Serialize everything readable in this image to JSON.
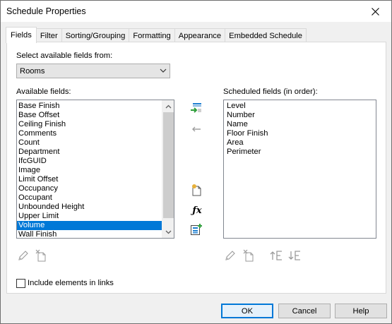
{
  "window": {
    "title": "Schedule Properties"
  },
  "tabs": [
    {
      "label": "Fields",
      "active": true
    },
    {
      "label": "Filter"
    },
    {
      "label": "Sorting/Grouping"
    },
    {
      "label": "Formatting"
    },
    {
      "label": "Appearance"
    },
    {
      "label": "Embedded Schedule"
    }
  ],
  "fields_tab": {
    "select_label": "Select available fields from:",
    "category_value": "Rooms",
    "available_label": "Available fields:",
    "available_fields": [
      "Base Finish",
      "Base Offset",
      "Ceiling Finish",
      "Comments",
      "Count",
      "Department",
      "IfcGUID",
      "Image",
      "Limit Offset",
      "Occupancy",
      "Occupant",
      "Unbounded Height",
      "Upper Limit",
      "Volume",
      "Wall Finish"
    ],
    "available_selected": "Volume",
    "scheduled_label": "Scheduled fields (in order):",
    "scheduled_fields": [
      "Level",
      "Number",
      "Name",
      "Floor Finish",
      "Area",
      "Perimeter"
    ],
    "include_links_label": "Include elements in links",
    "include_links_checked": false
  },
  "buttons": {
    "ok": "OK",
    "cancel": "Cancel",
    "help": "Help"
  },
  "colors": {
    "selection": "#0078d7",
    "accent_green": "#2e9e3a"
  },
  "icons": {
    "add_field": "add-field-icon",
    "remove_field": "remove-field-icon",
    "new_parameter": "new-parameter-icon",
    "calculated_value": "fx-icon",
    "combine_parameters": "combine-parameters-icon",
    "edit_parameter": "pencil-icon",
    "delete_parameter": "delete-parameter-icon",
    "move_up": "move-up-icon",
    "move_down": "move-down-icon"
  }
}
